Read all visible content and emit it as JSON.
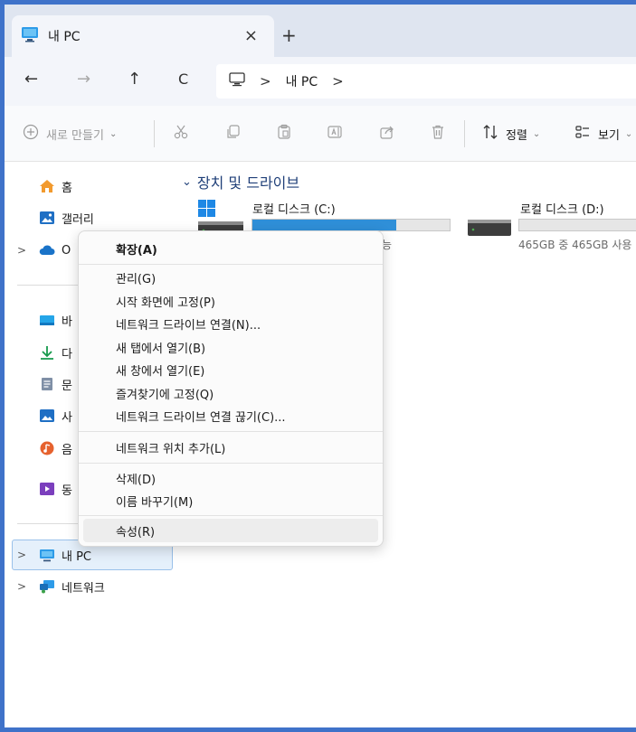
{
  "window": {
    "tab_title": "내 PC",
    "tab_close": "×",
    "new_tab": "+"
  },
  "navigation": {
    "back": "←",
    "forward": "→",
    "up": "↑",
    "refresh": "C",
    "breadcrumb_sep": ">",
    "location": "내 PC",
    "breadcrumb_end": ">"
  },
  "toolbar": {
    "new_label": "새로 만들기",
    "sort_label": "정렬",
    "view_label": "보기",
    "caret": "⌄"
  },
  "sidebar": {
    "home": "홈",
    "gallery": "갤러리",
    "onedrive_partial": "O",
    "desktop_partial": "바",
    "downloads_partial": "다",
    "documents_partial": "문",
    "pictures_partial": "사",
    "music_partial": "음",
    "videos_partial": "동",
    "this_pc": "내 PC",
    "network": "네트워크",
    "chevron": ">"
  },
  "content": {
    "section_title": "장치 및 드라이브",
    "section_chevron": "⌄",
    "drives": [
      {
        "name": "로컬 디스크 (C:)",
        "size_partial": "가능",
        "used_fraction": 0.73
      },
      {
        "name": "로컬 디스크 (D:)",
        "size_text": "465GB 중 465GB 사용",
        "used_fraction": 0.0
      }
    ]
  },
  "context_menu": {
    "items": [
      "확장(A)",
      "관리(G)",
      "시작 화면에 고정(P)",
      "네트워크 드라이브 연결(N)...",
      "새 탭에서 열기(B)",
      "새 창에서 열기(E)",
      "즐겨찾기에 고정(Q)",
      "네트워크 드라이브 연결 끊기(C)...",
      "네트워크 위치 추가(L)",
      "삭제(D)",
      "이름 바꾸기(M)",
      "속성(R)"
    ]
  },
  "colors": {
    "accent": "#3f72c9",
    "drive_bar": "#2f8fd8",
    "selection": "#e5f0fb"
  }
}
